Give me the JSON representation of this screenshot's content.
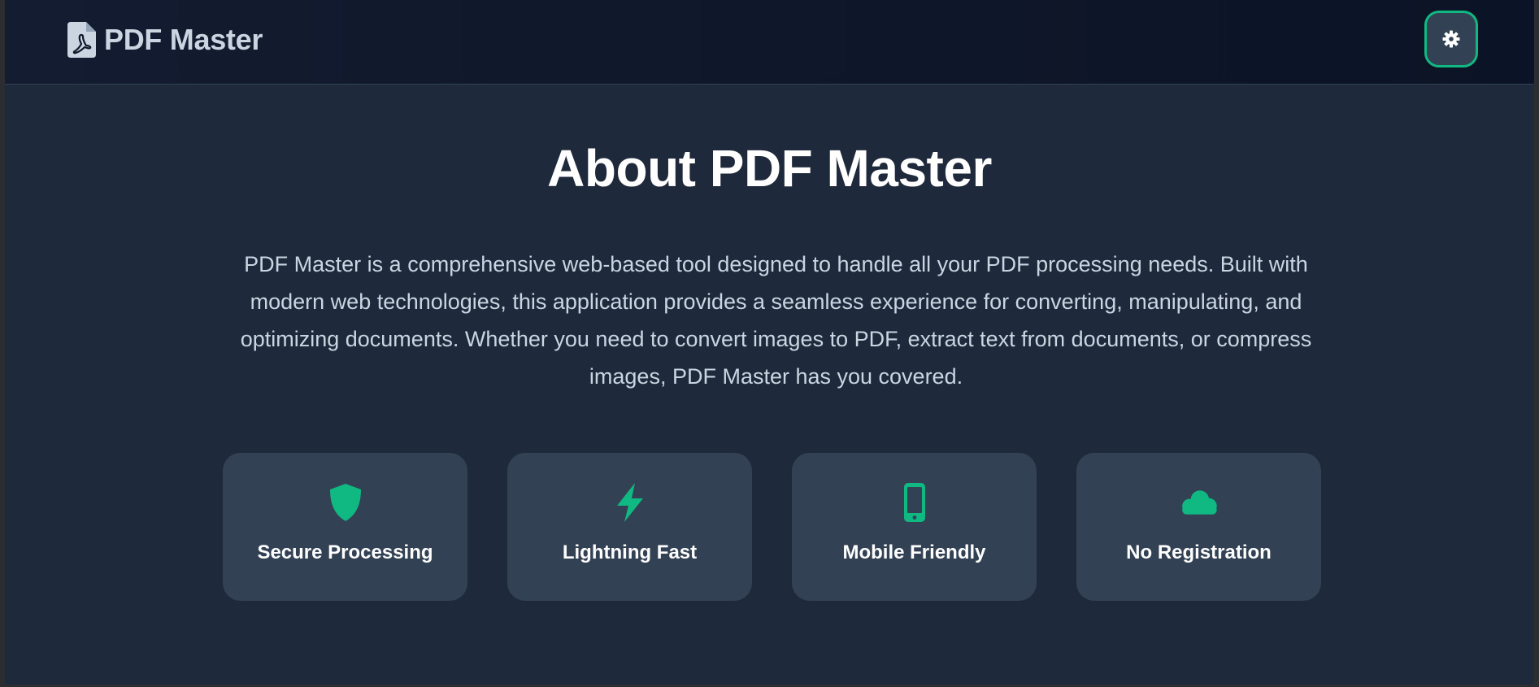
{
  "header": {
    "brand_name": "PDF Master",
    "brand_icon": "file-pdf-icon",
    "settings_icon": "gear-icon"
  },
  "about": {
    "title": "About PDF Master",
    "description": "PDF Master is a comprehensive web-based tool designed to handle all your PDF processing needs. Built with modern web technologies, this application provides a seamless experience for converting, manipulating, and optimizing documents. Whether you need to convert images to PDF, extract text from documents, or compress images, PDF Master has you covered."
  },
  "features": [
    {
      "label": "Secure Processing",
      "icon": "shield-icon"
    },
    {
      "label": "Lightning Fast",
      "icon": "bolt-icon"
    },
    {
      "label": "Mobile Friendly",
      "icon": "mobile-phone-icon"
    },
    {
      "label": "No Registration",
      "icon": "cloud-icon"
    }
  ],
  "colors": {
    "accent": "#10b981",
    "page_background": "#1e293b",
    "header_background": "#0f172a",
    "card_background": "#334155"
  }
}
